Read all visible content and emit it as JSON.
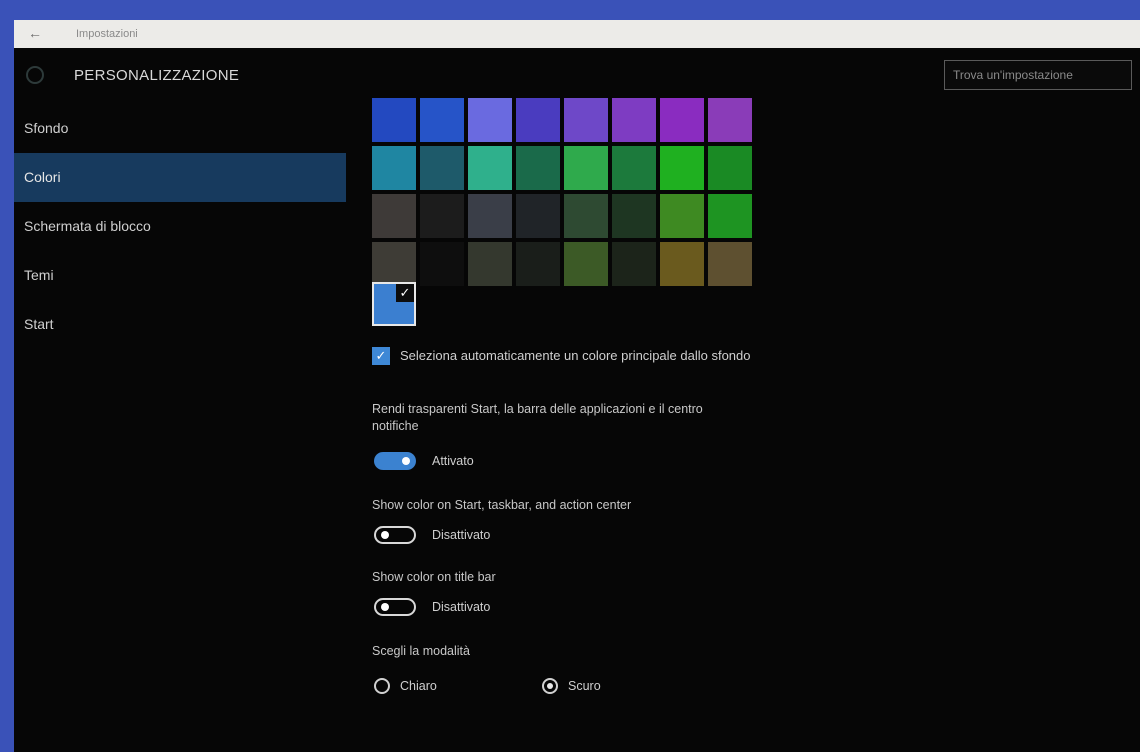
{
  "window": {
    "title": "Impostazioni",
    "back_glyph": "←"
  },
  "header": {
    "title": "PERSONALIZZAZIONE",
    "icon": "gear-icon"
  },
  "search": {
    "placeholder": "Trova un'impostazione"
  },
  "nav": {
    "items": [
      {
        "label": "Sfondo"
      },
      {
        "label": "Colori"
      },
      {
        "label": "Schermata di blocco"
      },
      {
        "label": "Temi"
      },
      {
        "label": "Start"
      }
    ],
    "active_index": 1
  },
  "palette": {
    "colors": [
      "#2349c0",
      "#2654c8",
      "#6a6ae0",
      "#4a3cbf",
      "#6e48c8",
      "#7e3cc2",
      "#8a2cc0",
      "#8a3cb8",
      "#1f86a2",
      "#1e5a6a",
      "#2fb08c",
      "#1a6a4a",
      "#2faa4c",
      "#1c7a3c",
      "#1fb020",
      "#1a8a24",
      "#3e3a38",
      "#1c1c1c",
      "#3a3e48",
      "#202428",
      "#2e4a32",
      "#1e3622",
      "#3e8a22",
      "#1e9422",
      "#3e3c36",
      "#0e0e0e",
      "#34382e",
      "#1a1e1a",
      "#3c5a26",
      "#1c241a",
      "#6a5a1e",
      "#5e5030"
    ],
    "custom_color": "#3b7fd0",
    "selected_mark": "✓"
  },
  "auto_color": {
    "checked": true,
    "mark": "✓",
    "label": "Seleziona automaticamente un colore principale dallo sfondo"
  },
  "transparency": {
    "label_line1": "Rendi trasparenti Start, la barra delle applicazioni e il centro",
    "label_line2": "notifiche",
    "state_text": "Attivato"
  },
  "show_color_start": {
    "label": "Show color on Start, taskbar, and action center",
    "state_text": "Disattivato"
  },
  "show_color_title": {
    "label": "Show color on title bar",
    "state_text": "Disattivato"
  },
  "mode": {
    "label": "Scegli la modalità",
    "options": [
      {
        "label": "Chiaro",
        "checked": false
      },
      {
        "label": "Scuro",
        "checked": true
      }
    ]
  },
  "colors": {
    "accent": "#3b82d0",
    "nav_active": "#173a5e",
    "background": "#060606"
  }
}
